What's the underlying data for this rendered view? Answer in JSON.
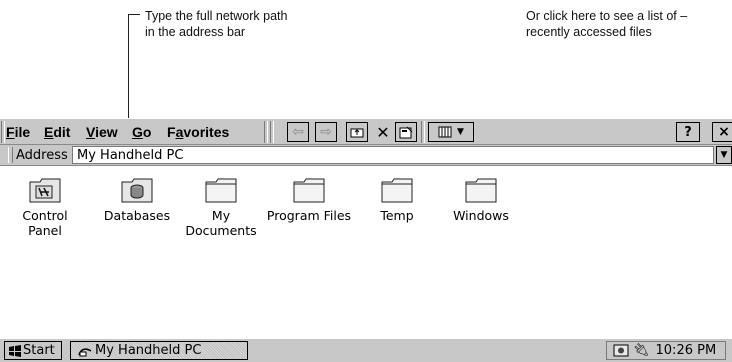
{
  "callouts": {
    "left": {
      "line1": "Type the full network path",
      "line2": "in the address bar"
    },
    "right": {
      "line1": "Or click here to see a list of",
      "line2": "recently accessed files"
    }
  },
  "menu": {
    "file": "File",
    "edit": "Edit",
    "view": "View",
    "go": "Go",
    "favorites": "Favorites"
  },
  "toolbar": {
    "back": "⇦",
    "forward": "⇨",
    "close": "✕",
    "help": "?",
    "window_close": "×"
  },
  "address": {
    "label": "Address",
    "value": "My Handheld PC"
  },
  "icons": [
    {
      "label": "Control\nPanel",
      "icon": "control-panel-icon"
    },
    {
      "label": "Databases",
      "icon": "databases-icon"
    },
    {
      "label": "My\nDocuments",
      "icon": "folder-icon"
    },
    {
      "label": "Program Files",
      "icon": "folder-icon"
    },
    {
      "label": "Temp",
      "icon": "folder-icon"
    },
    {
      "label": "Windows",
      "icon": "folder-icon"
    }
  ],
  "taskbar": {
    "start": "Start",
    "task": "My Handheld PC",
    "time": "10:26 PM"
  }
}
